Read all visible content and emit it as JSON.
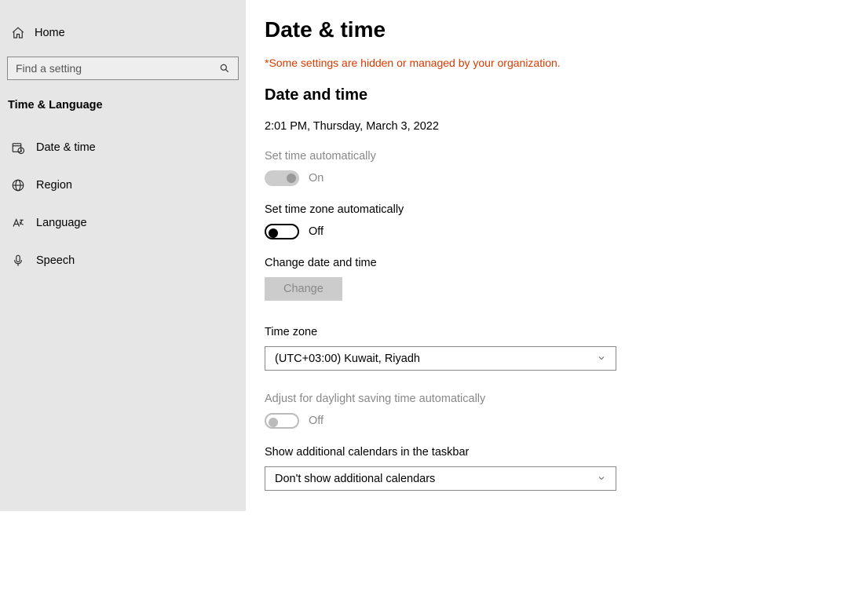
{
  "sidebar": {
    "home_label": "Home",
    "search_placeholder": "Find a setting",
    "category_title": "Time & Language",
    "items": [
      {
        "label": "Date & time"
      },
      {
        "label": "Region"
      },
      {
        "label": "Language"
      },
      {
        "label": "Speech"
      }
    ]
  },
  "main": {
    "page_title": "Date & time",
    "warning_text": "*Some settings are hidden or managed by your organization.",
    "section_heading": "Date and time",
    "current_datetime": "2:01 PM, Thursday, March 3, 2022",
    "set_time_auto": {
      "label": "Set time automatically",
      "state": "On"
    },
    "set_tz_auto": {
      "label": "Set time zone automatically",
      "state": "Off"
    },
    "change_dt": {
      "label": "Change date and time",
      "button": "Change"
    },
    "timezone": {
      "label": "Time zone",
      "value": "(UTC+03:00) Kuwait, Riyadh"
    },
    "dst": {
      "label": "Adjust for daylight saving time automatically",
      "state": "Off"
    },
    "additional_cal": {
      "label": "Show additional calendars in the taskbar",
      "value": "Don't show additional calendars"
    }
  }
}
